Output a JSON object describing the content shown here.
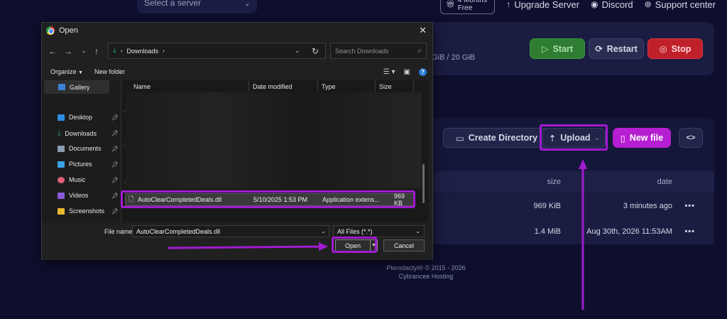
{
  "panel": {
    "server_select_placeholder": "Select a server",
    "top_nav": {
      "badge": "4 Months Free",
      "upgrade": "Upgrade Server",
      "discord": "Discord",
      "support": "Support center"
    },
    "disk_usage": "GiB / 20 GiB",
    "power": {
      "start": "Start",
      "restart": "Restart",
      "stop": "Stop"
    },
    "file_actions": {
      "create_directory": "Create Directory",
      "upload": "Upload",
      "new_file": "New file",
      "code": "<>"
    },
    "table": {
      "headers": {
        "size": "size",
        "date": "date"
      },
      "rows": [
        {
          "size": "969 KiB",
          "date": "3 minutes ago",
          "menu": "•••"
        },
        {
          "size": "1.4 MiB",
          "date": "Aug 30th, 2026 11:53AM",
          "menu": "•••"
        }
      ]
    },
    "footer": {
      "line1": "Pterodactyl® © 2015 - 2026",
      "line2": "Cybrancee Hosting"
    }
  },
  "dialog": {
    "title": "Open",
    "close": "✕",
    "breadcrumb": "Downloads",
    "search_placeholder": "Search Downloads",
    "organize": "Organize",
    "new_folder": "New folder",
    "nav": [
      {
        "label": "Gallery",
        "pinned": false
      },
      {
        "label": "Desktop",
        "pinned": true
      },
      {
        "label": "Downloads",
        "pinned": true
      },
      {
        "label": "Documents",
        "pinned": true
      },
      {
        "label": "Pictures",
        "pinned": true
      },
      {
        "label": "Music",
        "pinned": true
      },
      {
        "label": "Videos",
        "pinned": true
      },
      {
        "label": "Screenshots",
        "pinned": true
      }
    ],
    "columns": {
      "name": "Name",
      "date_modified": "Date modified",
      "type": "Type",
      "size": "Size"
    },
    "selected_file": {
      "name": "AutoClearCompletedDeals.dll",
      "date_modified": "5/10/2025 1:53 PM",
      "type": "Application extens...",
      "size": "969 KB"
    },
    "file_name_label": "File name:",
    "file_name_value": "AutoClearCompletedDeals.dll",
    "file_type": "All Files (*.*)",
    "open_button": "Open",
    "cancel_button": "Cancel"
  },
  "colors": {
    "page_bg": "#0e0f2e",
    "accent_purple": "#a21bd1",
    "start_green": "#2f7d32",
    "stop_red": "#c0202a",
    "new_file_magenta": "#b51fd1"
  }
}
